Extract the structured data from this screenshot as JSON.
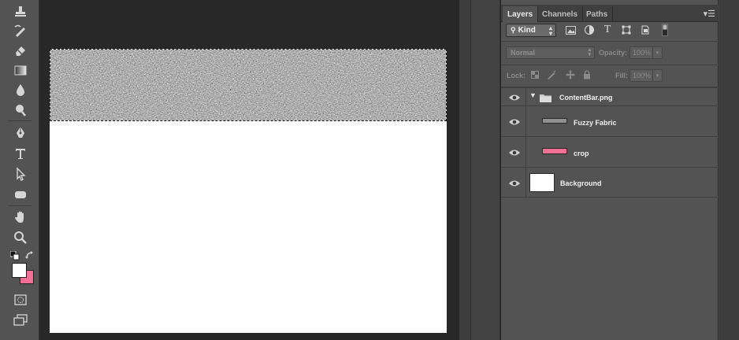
{
  "toolbar": {
    "tools": [
      {
        "name": "clone-stamp-tool-icon",
        "glyph": "⛁"
      },
      {
        "name": "history-brush-tool-icon",
        "glyph": "✎"
      },
      {
        "name": "eraser-tool-icon",
        "glyph": "◫"
      },
      {
        "name": "gradient-tool-icon",
        "glyph": "▦"
      },
      {
        "name": "blur-tool-icon",
        "glyph": "💧"
      },
      {
        "name": "dodge-tool-icon",
        "glyph": "⚲"
      },
      {
        "name": "pen-tool-icon",
        "glyph": "✒"
      },
      {
        "name": "type-tool-icon",
        "glyph": "T"
      },
      {
        "name": "path-selection-tool-icon",
        "glyph": "➤"
      },
      {
        "name": "rectangle-tool-icon",
        "glyph": "▭"
      },
      {
        "name": "hand-tool-icon",
        "glyph": "✋"
      },
      {
        "name": "zoom-tool-icon",
        "glyph": "🔍"
      }
    ],
    "foreground_color": "#ffffff",
    "background_color": "#f26f95"
  },
  "layers_panel": {
    "tabs": [
      "Layers",
      "Channels",
      "Paths"
    ],
    "active_tab": "Layers",
    "filter_kind": "Kind",
    "blend_mode": "Normal",
    "opacity_label": "Opacity:",
    "opacity_value": "100%",
    "lock_label": "Lock:",
    "fill_label": "Fill:",
    "fill_value": "100%",
    "layers": [
      {
        "name": "ContentBar.png",
        "type": "group"
      },
      {
        "name": "Fuzzy Fabric",
        "type": "layer",
        "thumb_color": "#8f8f8f"
      },
      {
        "name": "crop",
        "type": "layer",
        "thumb_color": "#f26f95"
      },
      {
        "name": "Background",
        "type": "background",
        "thumb_color": "#ffffff"
      }
    ]
  }
}
